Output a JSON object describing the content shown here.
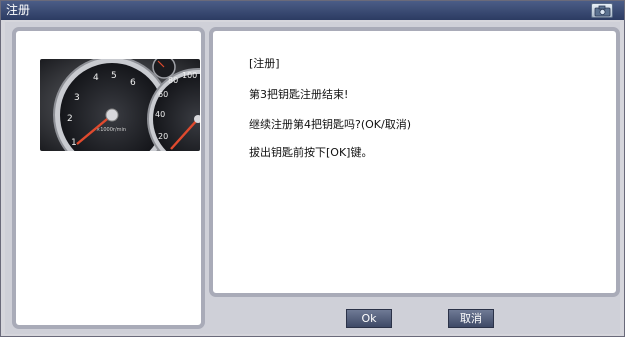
{
  "window": {
    "title": "注册"
  },
  "icons": {
    "camera": "camera-icon",
    "gauge": "instrument-cluster-image"
  },
  "message": {
    "line1": "[注册]",
    "line2": "第3把钥匙注册结束!",
    "line3": "继续注册第4把钥匙吗?(OK/取消)",
    "line4": "拔出钥匙前按下[OK]键。"
  },
  "buttons": {
    "ok": "Ok",
    "cancel": "取消"
  },
  "gauge_labels": {
    "left_dial": [
      "1",
      "2",
      "3",
      "4",
      "5",
      "6",
      "7"
    ],
    "right_dial": [
      "20",
      "40",
      "60",
      "80",
      "100"
    ],
    "unit": "×1000r/min"
  },
  "colors": {
    "titlebar": "#3a4a72",
    "panel_border": "#a9abb8",
    "button": "#4e5873",
    "needle": "#d8321e"
  }
}
